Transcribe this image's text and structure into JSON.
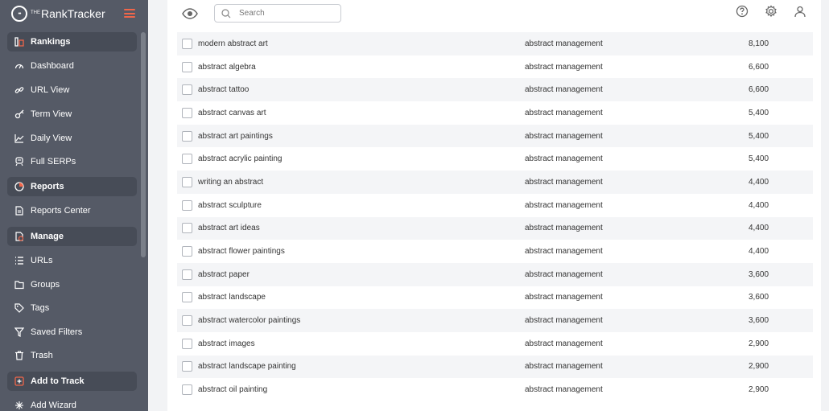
{
  "brand": {
    "logo_text": "••",
    "prefix": "THE",
    "name": "RankTracker"
  },
  "colors": {
    "accent": "#f0664a",
    "sidebar": "#555a66"
  },
  "sidebar": {
    "items": [
      {
        "label": "Rankings",
        "icon": "rankings-icon",
        "section": true
      },
      {
        "label": "Dashboard",
        "icon": "dashboard-icon"
      },
      {
        "label": "URL View",
        "icon": "link-icon"
      },
      {
        "label": "Term View",
        "icon": "key-icon"
      },
      {
        "label": "Daily View",
        "icon": "chart-icon"
      },
      {
        "label": "Full SERPs",
        "icon": "serp-icon"
      },
      {
        "label": "Reports",
        "icon": "pie-chart-icon",
        "section": true
      },
      {
        "label": "Reports Center",
        "icon": "document-icon"
      },
      {
        "label": "Manage",
        "icon": "manage-icon",
        "section": true
      },
      {
        "label": "URLs",
        "icon": "list-icon"
      },
      {
        "label": "Groups",
        "icon": "folder-icon"
      },
      {
        "label": "Tags",
        "icon": "tag-icon"
      },
      {
        "label": "Saved Filters",
        "icon": "filter-icon"
      },
      {
        "label": "Trash",
        "icon": "trash-icon"
      },
      {
        "label": "Add to Track",
        "icon": "plus-icon",
        "section": true
      },
      {
        "label": "Add Wizard",
        "icon": "wizard-icon"
      }
    ]
  },
  "toolbar": {
    "search_placeholder": "Search"
  },
  "rows": [
    {
      "keyword": "modern abstract art",
      "group": "abstract management",
      "volume": "8,100"
    },
    {
      "keyword": "abstract algebra",
      "group": "abstract management",
      "volume": "6,600"
    },
    {
      "keyword": "abstract tattoo",
      "group": "abstract management",
      "volume": "6,600"
    },
    {
      "keyword": "abstract canvas art",
      "group": "abstract management",
      "volume": "5,400"
    },
    {
      "keyword": "abstract art paintings",
      "group": "abstract management",
      "volume": "5,400"
    },
    {
      "keyword": "abstract acrylic painting",
      "group": "abstract management",
      "volume": "5,400"
    },
    {
      "keyword": "writing an abstract",
      "group": "abstract management",
      "volume": "4,400"
    },
    {
      "keyword": "abstract sculpture",
      "group": "abstract management",
      "volume": "4,400"
    },
    {
      "keyword": "abstract art ideas",
      "group": "abstract management",
      "volume": "4,400"
    },
    {
      "keyword": "abstract flower paintings",
      "group": "abstract management",
      "volume": "4,400"
    },
    {
      "keyword": "abstract paper",
      "group": "abstract management",
      "volume": "3,600"
    },
    {
      "keyword": "abstract landscape",
      "group": "abstract management",
      "volume": "3,600"
    },
    {
      "keyword": "abstract watercolor paintings",
      "group": "abstract management",
      "volume": "3,600"
    },
    {
      "keyword": "abstract images",
      "group": "abstract management",
      "volume": "2,900"
    },
    {
      "keyword": "abstract landscape painting",
      "group": "abstract management",
      "volume": "2,900"
    },
    {
      "keyword": "abstract oil painting",
      "group": "abstract management",
      "volume": "2,900"
    }
  ]
}
